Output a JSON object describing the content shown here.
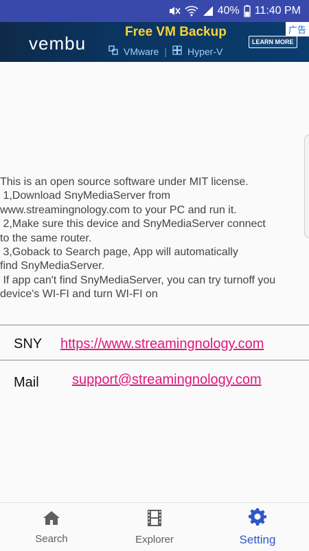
{
  "status_bar": {
    "battery": "40%",
    "time": "11:40 PM"
  },
  "ad": {
    "brand": "vembu",
    "headline": "Free VM Backup",
    "option_1": "VMware",
    "option_2": "Hyper-V",
    "cta": "LEARN MORE",
    "ad_tag": "广告"
  },
  "info": {
    "lines": [
      "This is an open source software under MIT license.",
      " 1,Download SnyMediaServer from",
      "www.streamingnology.com to your PC and run it.",
      " 2,Make sure this device and SnyMediaServer connect",
      "to the same router.",
      " 3,Goback to Search page, App will automatically",
      "find SnyMediaServer.",
      " If app can't find SnyMediaServer, you can try turnoff you",
      "device's WI-FI and turn WI-FI on"
    ]
  },
  "links": {
    "sny_label": "SNY",
    "sny_url": "https://www.streamingnology.com",
    "mail_label": "Mail",
    "mail_address": "support@streamingnology.com"
  },
  "nav": {
    "search": "Search",
    "explorer": "Explorer",
    "setting": "Setting",
    "active": "setting",
    "active_color": "#2e57c7"
  },
  "icons": [
    "mute-icon",
    "wifi-icon",
    "signal-icon",
    "home-icon",
    "film-icon",
    "gear-icon"
  ]
}
